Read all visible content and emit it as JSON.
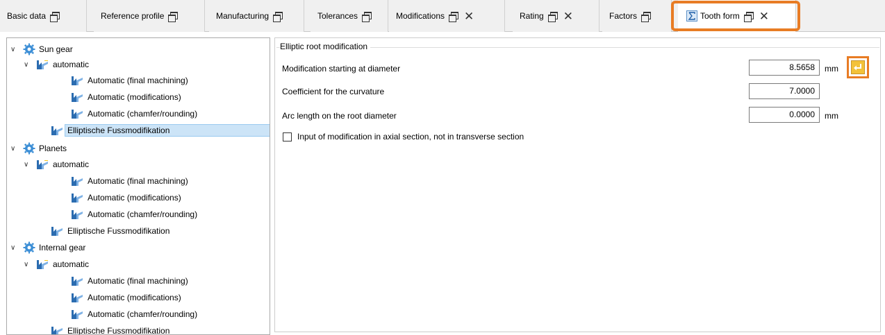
{
  "tabs": [
    {
      "label": "Basic data",
      "closable": false
    },
    {
      "label": "Reference profile",
      "closable": false
    },
    {
      "label": "Manufacturing",
      "closable": false
    },
    {
      "label": "Tolerances",
      "closable": false
    },
    {
      "label": "Modifications",
      "closable": true
    },
    {
      "label": "Rating",
      "closable": true
    },
    {
      "label": "Factors",
      "closable": false
    },
    {
      "label": "Tooth form",
      "closable": true,
      "active": true
    }
  ],
  "tree": {
    "sun_gear": {
      "label": "Sun gear",
      "automatic": "automatic",
      "children": [
        "Automatic (final machining)",
        "Automatic (modifications)",
        "Automatic (chamfer/rounding)"
      ],
      "elliptic": "Elliptische Fussmodifikation"
    },
    "planets": {
      "label": "Planets",
      "automatic": "automatic",
      "children": [
        "Automatic (final machining)",
        "Automatic (modifications)",
        "Automatic (chamfer/rounding)"
      ],
      "elliptic": "Elliptische Fussmodifikation"
    },
    "internal_gear": {
      "label": "Internal gear",
      "automatic": "automatic",
      "children": [
        "Automatic (final machining)",
        "Automatic (modifications)",
        "Automatic (chamfer/rounding)"
      ],
      "elliptic": "Elliptische Fussmodifikation"
    }
  },
  "form": {
    "group_title": "Elliptic root modification",
    "fields": [
      {
        "label": "Modification starting at diameter",
        "value": "8.5658",
        "unit": "mm"
      },
      {
        "label": "Coefficient for the curvature",
        "value": "7.0000",
        "unit": ""
      },
      {
        "label": "Arc length on the root diameter",
        "value": "0.0000",
        "unit": "mm"
      }
    ],
    "checkbox_label": "Input of modification in axial section, not in transverse section",
    "checkbox_checked": false
  },
  "colors": {
    "highlight": "#e87c24",
    "selection": "#cce4f7",
    "gear_blue": "#3d8fd6",
    "apply_yellow": "#f3c239"
  }
}
